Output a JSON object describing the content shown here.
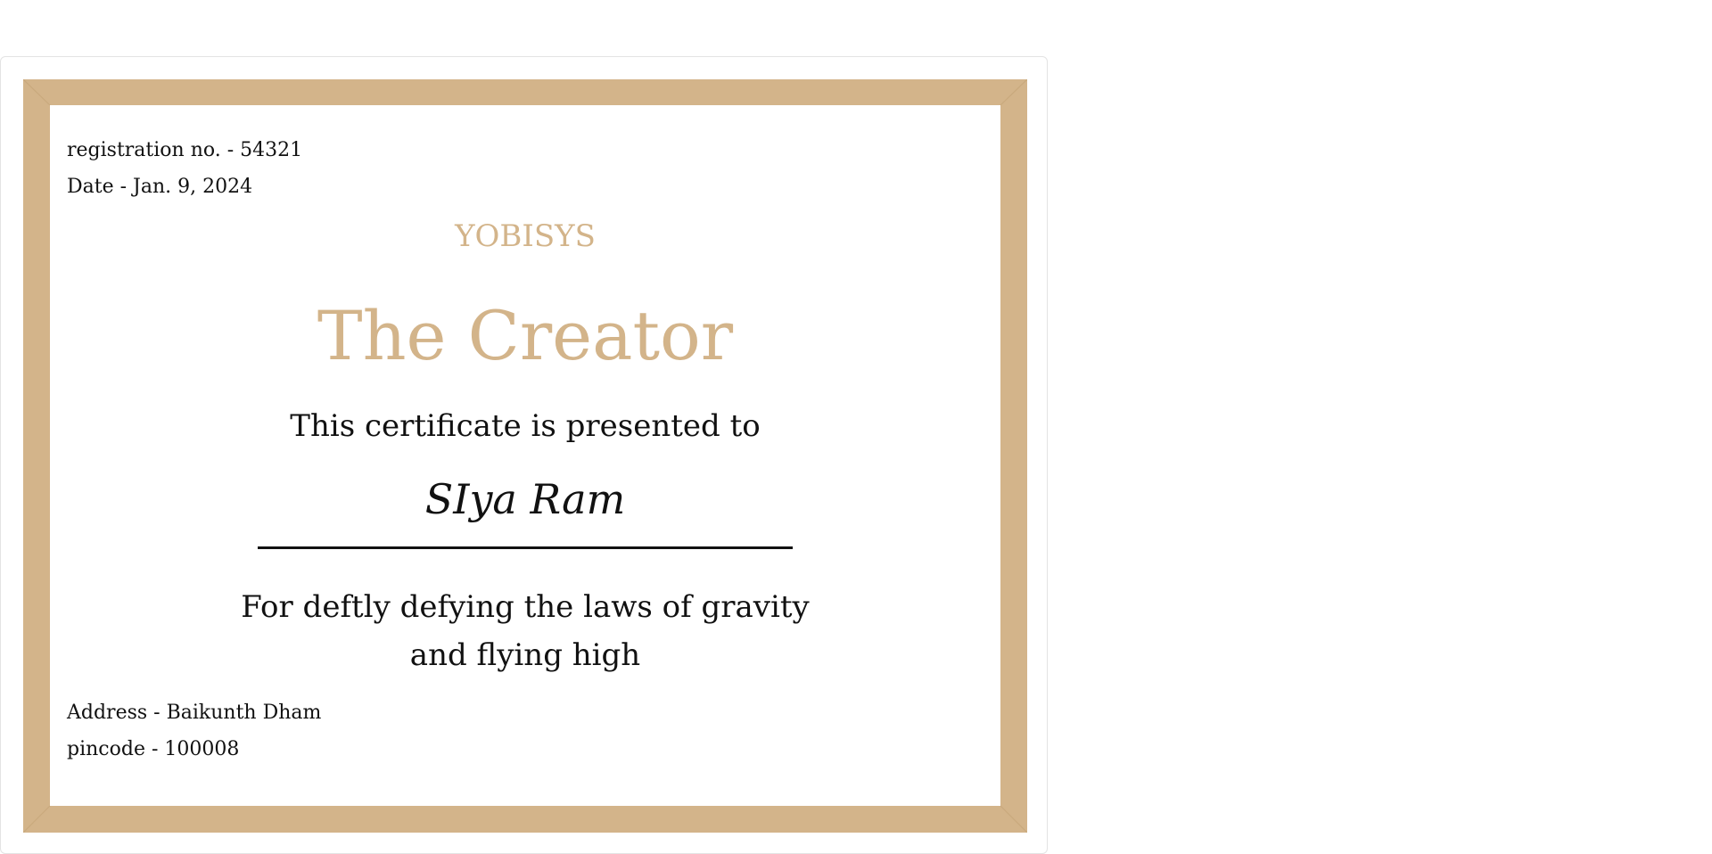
{
  "certificate": {
    "registration": "registration no. - 54321",
    "date": "Date - Jan. 9, 2024",
    "brand": "YOBISYS",
    "title": "The Creator",
    "presented_to": "This certificate is presented to",
    "recipient": "SIya Ram",
    "reason_line1": "For deftly defying the laws of gravity",
    "reason_line2": "and flying high",
    "address": "Address - Baikunth Dham",
    "pincode": "pincode - 100008"
  },
  "colors": {
    "frame": "#d3b48a",
    "accent_text": "#d3b48a",
    "body_text": "#111111",
    "background": "#ffffff"
  }
}
